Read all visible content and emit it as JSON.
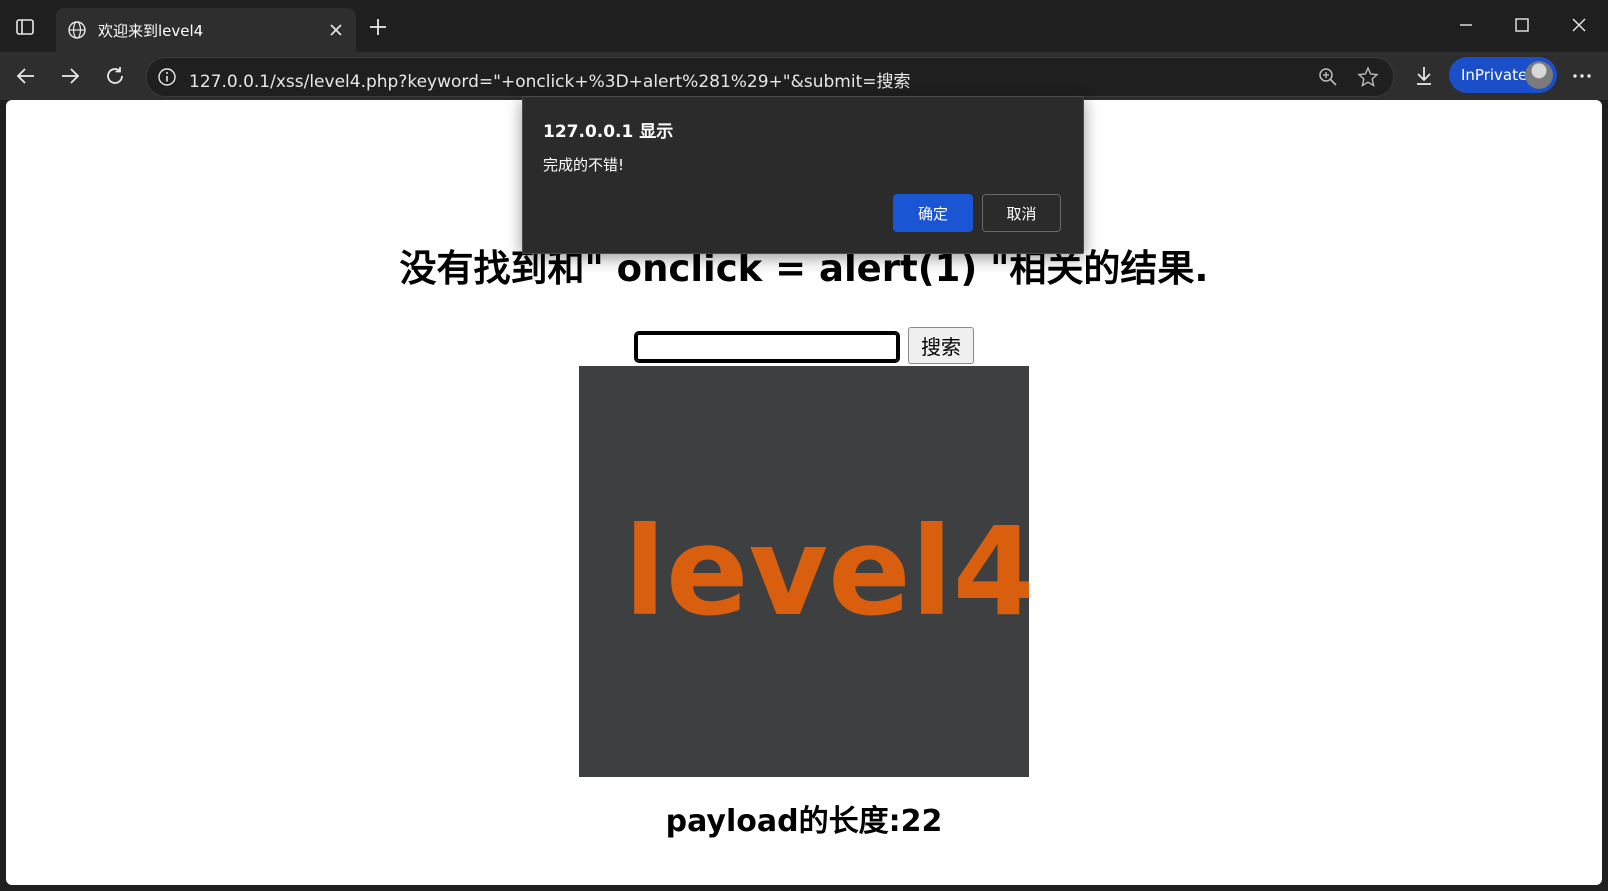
{
  "browser": {
    "tab": {
      "title": "欢迎来到level4",
      "favicon": "globe-icon"
    },
    "address": {
      "url": "127.0.0.1/xss/level4.php?keyword=\"+onclick+%3D+alert%281%29+\"&submit=搜索"
    },
    "inprivate_label": "InPrivate"
  },
  "page": {
    "heading": "没有找到和\" onclick = alert(1) \"相关的结果.",
    "search": {
      "value": "",
      "button_label": "搜索"
    },
    "image": {
      "text": "level4",
      "text_color": "#d95f0e",
      "background": "#3e3f41"
    },
    "payload_length": "payload的长度:22"
  },
  "dialog": {
    "title": "127.0.0.1 显示",
    "message": "完成的不错!",
    "ok_label": "确定",
    "cancel_label": "取消"
  },
  "colors": {
    "accent": "#1a56d4",
    "inprivate": "#1a4fc9",
    "chrome_dark": "#1f1f1f"
  }
}
